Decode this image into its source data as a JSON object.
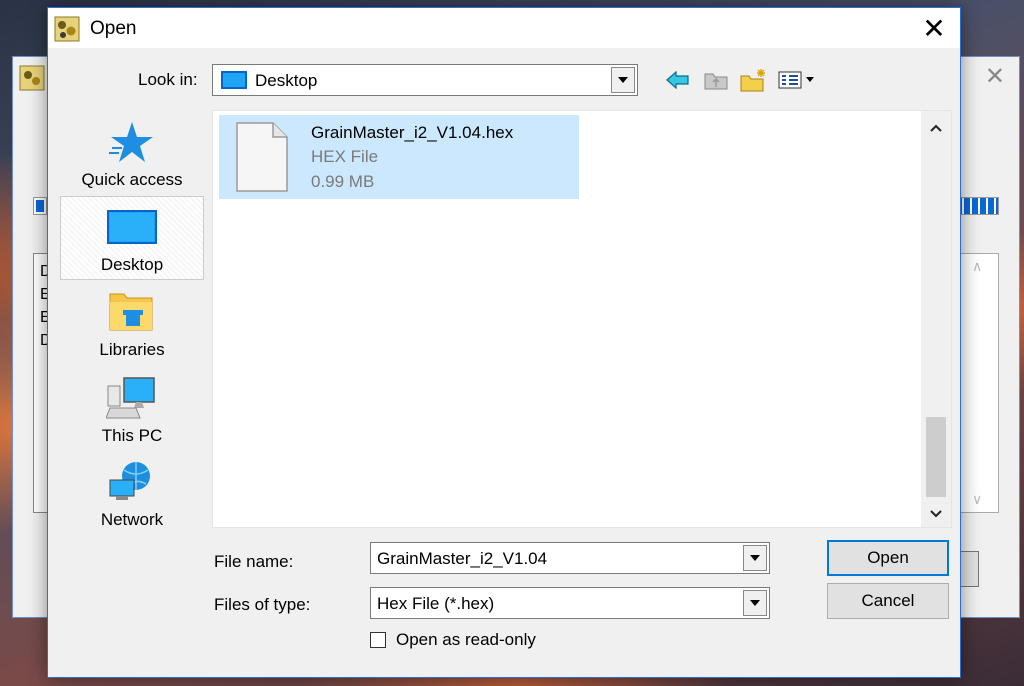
{
  "background_window": {
    "log_lines": [
      "D",
      "E",
      "E",
      "D"
    ]
  },
  "dialog": {
    "title": "Open",
    "close_glyph": "✕",
    "look_in": {
      "label": "Look in:",
      "value": "Desktop"
    },
    "toolbar": {
      "back_icon": "back-arrow-icon",
      "up_icon": "up-folder-icon",
      "new_folder_icon": "new-folder-icon",
      "view_menu_icon": "view-menu-icon"
    },
    "places": [
      {
        "label": "Quick access",
        "icon": "star-icon",
        "selected": false
      },
      {
        "label": "Desktop",
        "icon": "desktop-icon",
        "selected": true
      },
      {
        "label": "Libraries",
        "icon": "libraries-icon",
        "selected": false
      },
      {
        "label": "This PC",
        "icon": "computer-icon",
        "selected": false
      },
      {
        "label": "Network",
        "icon": "network-icon",
        "selected": false
      }
    ],
    "files": [
      {
        "name": "GrainMaster_i2_V1.04.hex",
        "type": "HEX File",
        "size": "0.99 MB",
        "selected": true
      }
    ],
    "file_name": {
      "label": "File name:",
      "value": "GrainMaster_i2_V1.04"
    },
    "file_type": {
      "label": "Files of type:",
      "value": "Hex File (*.hex)"
    },
    "buttons": {
      "open": "Open",
      "cancel": "Cancel"
    },
    "read_only": {
      "label": "Open as read-only",
      "checked": false
    },
    "colors": {
      "accent": "#0078d7",
      "selection": "#cce8ff"
    }
  }
}
